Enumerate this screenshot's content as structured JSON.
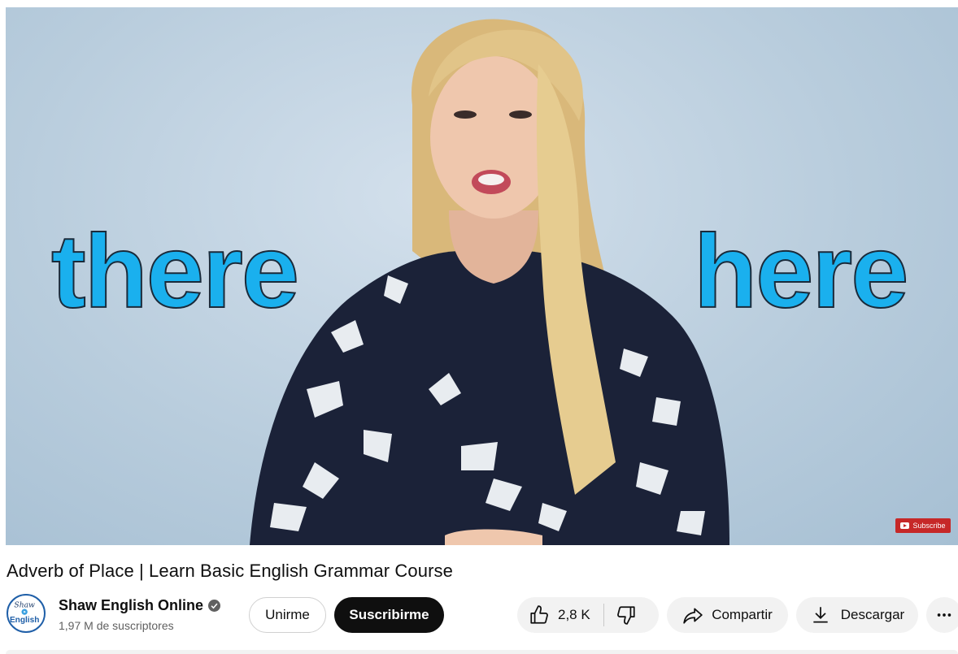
{
  "video": {
    "overlay_left": "there",
    "overlay_right": "here",
    "subscribe_badge": "Subscribe"
  },
  "title": "Adverb of Place | Learn Basic English Grammar Course",
  "channel": {
    "avatar_line1": "Shaw",
    "avatar_line2": "English",
    "name": "Shaw English Online",
    "subscribers": "1,97 M de suscriptores"
  },
  "actions": {
    "join_label": "Unirme",
    "subscribe_label": "Suscribirme",
    "like_count": "2,8 K",
    "share_label": "Compartir",
    "download_label": "Descargar"
  },
  "icons": {
    "like": "thumbs-up-icon",
    "dislike": "thumbs-down-icon",
    "share": "share-icon",
    "download": "download-icon",
    "more": "more-horizontal-icon",
    "verified": "verified-check-icon"
  },
  "colors": {
    "overlay_text": "#1ab0ee",
    "subscribe_button": "#0f0f0f",
    "action_bg": "#f2f2f2"
  }
}
